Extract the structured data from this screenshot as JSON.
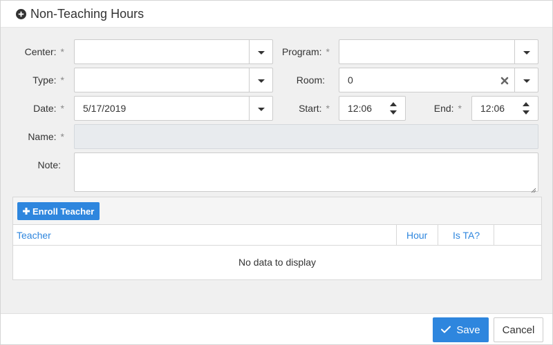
{
  "dialog": {
    "title": "Non-Teaching Hours",
    "title_icon": "plus-circle-icon"
  },
  "form": {
    "required_mark": "*",
    "center": {
      "label": "Center:",
      "value": ""
    },
    "program": {
      "label": "Program:",
      "value": ""
    },
    "type": {
      "label": "Type:",
      "value": ""
    },
    "room": {
      "label": "Room:",
      "value": "0"
    },
    "date": {
      "label": "Date:",
      "value": "5/17/2019"
    },
    "start": {
      "label": "Start:",
      "value": "12:06"
    },
    "end": {
      "label": "End:",
      "value": "12:06"
    },
    "name": {
      "label": "Name:",
      "value": ""
    },
    "note": {
      "label": "Note:",
      "value": ""
    }
  },
  "grid": {
    "enroll_button": "Enroll Teacher",
    "columns": [
      "Teacher",
      "Hour",
      "Is TA?"
    ],
    "empty_text": "No data to display"
  },
  "footer": {
    "save_label": "Save",
    "cancel_label": "Cancel"
  },
  "colors": {
    "accent": "#2e86de",
    "body_bg": "#f0f0f0"
  }
}
